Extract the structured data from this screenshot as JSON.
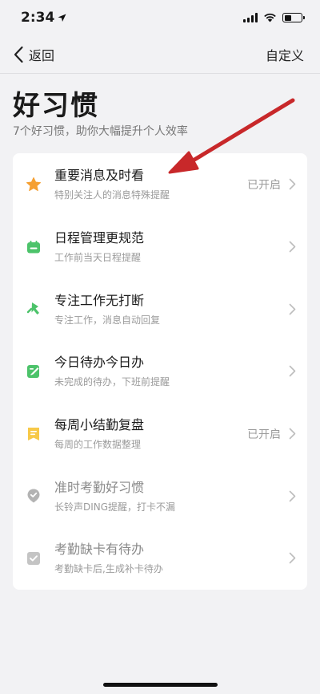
{
  "status_bar": {
    "time": "2:34",
    "battery_level": 0.4
  },
  "nav": {
    "back_label": "返回",
    "action_label": "自定义"
  },
  "header": {
    "title": "好习惯",
    "subtitle": "7个好习惯，助你大幅提升个人效率"
  },
  "habits": [
    {
      "title": "重要消息及时看",
      "desc": "特别关注人的消息特殊提醒",
      "status": "已开启",
      "icon": "star-icon",
      "color": "#f5a033",
      "dim": false
    },
    {
      "title": "日程管理更规范",
      "desc": "工作前当天日程提醒",
      "status": "",
      "icon": "calendar-icon",
      "color": "#4cc36a",
      "dim": false
    },
    {
      "title": "专注工作无打断",
      "desc": "专注工作，消息自动回复",
      "status": "",
      "icon": "focus-icon",
      "color": "#4cc36a",
      "dim": false
    },
    {
      "title": "今日待办今日办",
      "desc": "未完成的待办，下班前提醒",
      "status": "",
      "icon": "todo-edit-icon",
      "color": "#4cc36a",
      "dim": false
    },
    {
      "title": "每周小结勤复盘",
      "desc": "每周的工作数据整理",
      "status": "已开启",
      "icon": "summary-icon",
      "color": "#f7c948",
      "dim": false
    },
    {
      "title": "准时考勤好习惯",
      "desc": "长铃声DING提醒，打卡不漏",
      "status": "",
      "icon": "location-check-icon",
      "color": "#b3b3b3",
      "dim": true
    },
    {
      "title": "考勤缺卡有待办",
      "desc": "考勤缺卡后,生成补卡待办",
      "status": "",
      "icon": "checkbox-icon",
      "color": "#c4c4c4",
      "dim": true
    }
  ],
  "colors": {
    "annotation_arrow": "#c8282a",
    "background": "#f2f2f4",
    "card": "#ffffff"
  }
}
